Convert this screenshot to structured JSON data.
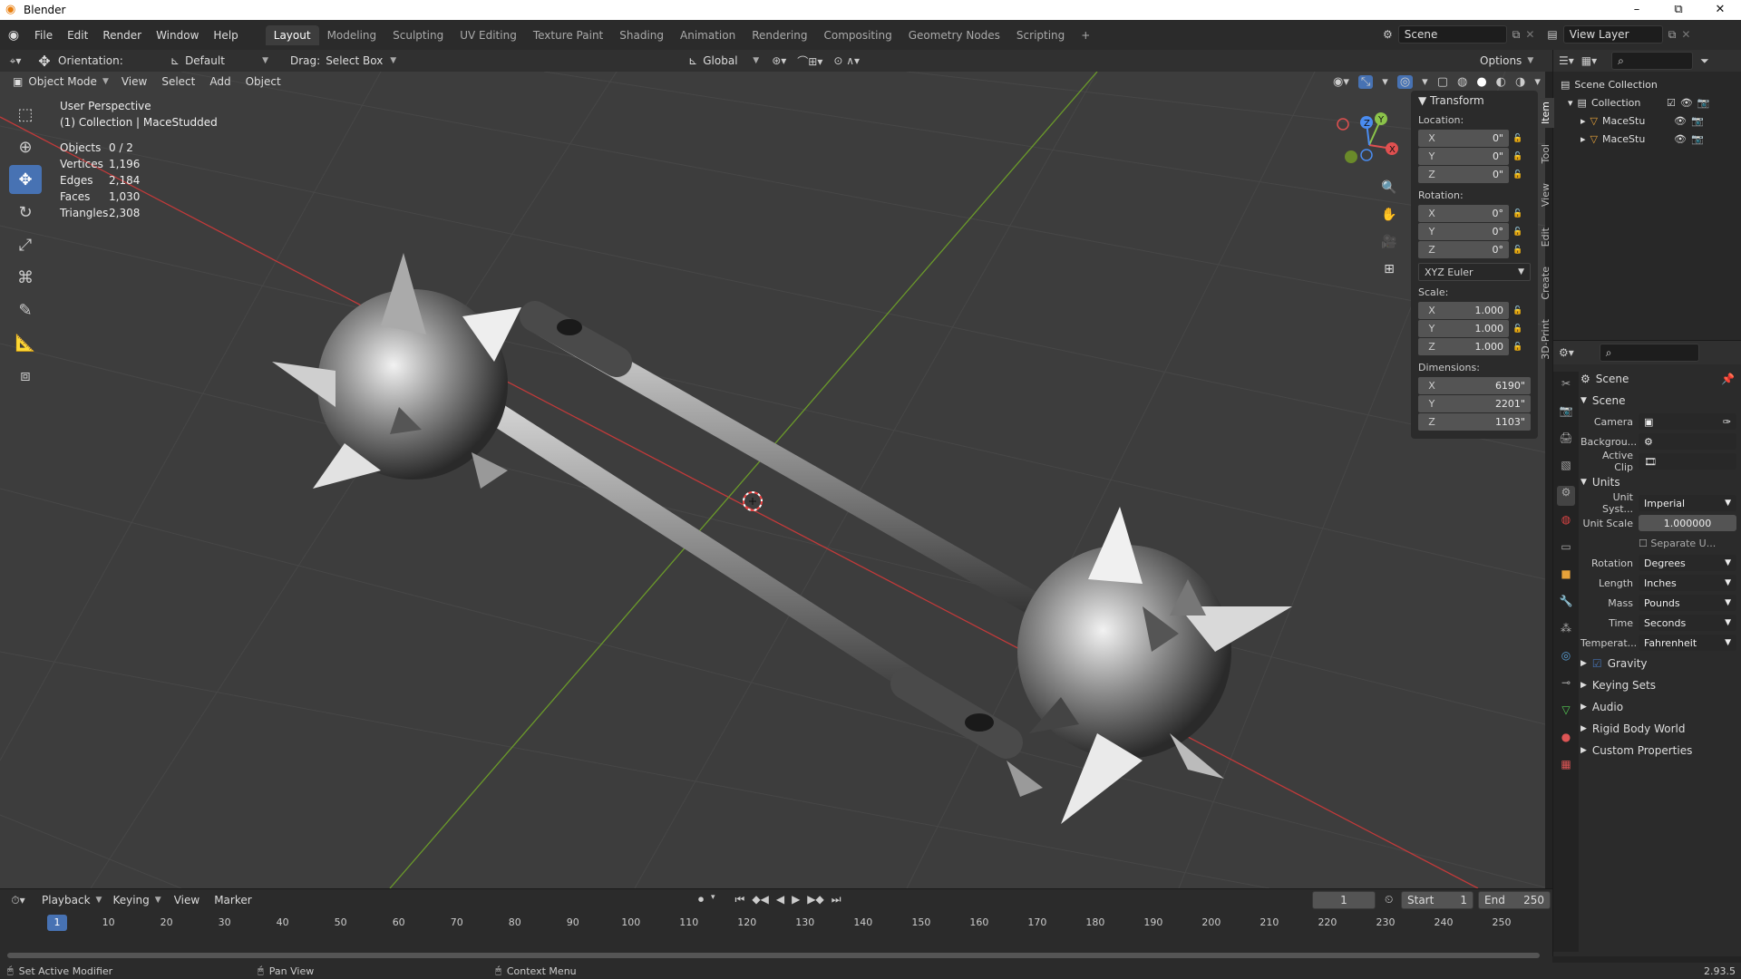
{
  "window": {
    "title": "Blender",
    "min": "–",
    "max": "⧉",
    "close": "✕"
  },
  "menus": [
    "File",
    "Edit",
    "Render",
    "Window",
    "Help"
  ],
  "workspaces": [
    "Layout",
    "Modeling",
    "Sculpting",
    "UV Editing",
    "Texture Paint",
    "Shading",
    "Animation",
    "Rendering",
    "Compositing",
    "Geometry Nodes",
    "Scripting",
    "+"
  ],
  "scene": {
    "label": "Scene",
    "view_layer": "View Layer"
  },
  "header": {
    "orientation_label": "Orientation:",
    "orientation_value": "Default",
    "drag_label": "Drag:",
    "drag_value": "Select Box",
    "transform": "Global",
    "options": "Options"
  },
  "mode": {
    "value": "Object Mode",
    "view": "View",
    "select": "Select",
    "add": "Add",
    "object": "Object"
  },
  "viewport": {
    "perspective": "User Perspective",
    "collection": "(1) Collection | MaceStudded"
  },
  "stats": [
    {
      "k": "Objects",
      "v": "0 / 2"
    },
    {
      "k": "Vertices",
      "v": "1,196"
    },
    {
      "k": "Edges",
      "v": "2,184"
    },
    {
      "k": "Faces",
      "v": "1,030"
    },
    {
      "k": "Triangles",
      "v": "2,308"
    }
  ],
  "npanel": {
    "header": "Transform",
    "location": "Location:",
    "rotation": "Rotation:",
    "scale": "Scale:",
    "dimensions": "Dimensions:",
    "loc": [
      {
        "a": "X",
        "v": "0\""
      },
      {
        "a": "Y",
        "v": "0\""
      },
      {
        "a": "Z",
        "v": "0\""
      }
    ],
    "rot": [
      {
        "a": "X",
        "v": "0°"
      },
      {
        "a": "Y",
        "v": "0°"
      },
      {
        "a": "Z",
        "v": "0°"
      }
    ],
    "euler": "XYZ Euler",
    "scl": [
      {
        "a": "X",
        "v": "1.000"
      },
      {
        "a": "Y",
        "v": "1.000"
      },
      {
        "a": "Z",
        "v": "1.000"
      }
    ],
    "dim": [
      {
        "a": "X",
        "v": "6190\""
      },
      {
        "a": "Y",
        "v": "2201\""
      },
      {
        "a": "Z",
        "v": "1103\""
      }
    ]
  },
  "sidetabs": [
    "Item",
    "Tool",
    "View",
    "Edit",
    "Create",
    "3D-Print"
  ],
  "outliner": {
    "root": "Scene Collection",
    "collection": "Collection",
    "items": [
      "MaceStu",
      "MaceStu"
    ]
  },
  "properties": {
    "scene_name": "Scene",
    "scene_panel": "Scene",
    "camera": "Camera",
    "background": "Backgrou...",
    "active_clip": "Active Clip",
    "units_panel": "Units",
    "unit_system_label": "Unit Syst...",
    "unit_system": "Imperial",
    "unit_scale_label": "Unit Scale",
    "unit_scale": "1.000000",
    "separate": "Separate U...",
    "rotation_label": "Rotation",
    "rotation": "Degrees",
    "length_label": "Length",
    "length": "Inches",
    "mass_label": "Mass",
    "mass": "Pounds",
    "time_label": "Time",
    "time": "Seconds",
    "temp_label": "Temperat...",
    "temp": "Fahrenheit",
    "gravity": "Gravity",
    "keying_sets": "Keying Sets",
    "audio": "Audio",
    "rigid_body": "Rigid Body World",
    "custom": "Custom Properties"
  },
  "timeline": {
    "playback": "Playback",
    "keying": "Keying",
    "view": "View",
    "marker": "Marker",
    "current": "1",
    "start_label": "Start",
    "start": "1",
    "end_label": "End",
    "end": "250",
    "ticks": [
      "1",
      "10",
      "20",
      "30",
      "40",
      "50",
      "60",
      "70",
      "80",
      "90",
      "100",
      "110",
      "120",
      "130",
      "140",
      "150",
      "160",
      "170",
      "180",
      "190",
      "200",
      "210",
      "220",
      "230",
      "240",
      "250"
    ]
  },
  "status": {
    "left": "Set Active Modifier",
    "mid": "Pan View",
    "right": "Context Menu",
    "version": "2.93.5"
  }
}
